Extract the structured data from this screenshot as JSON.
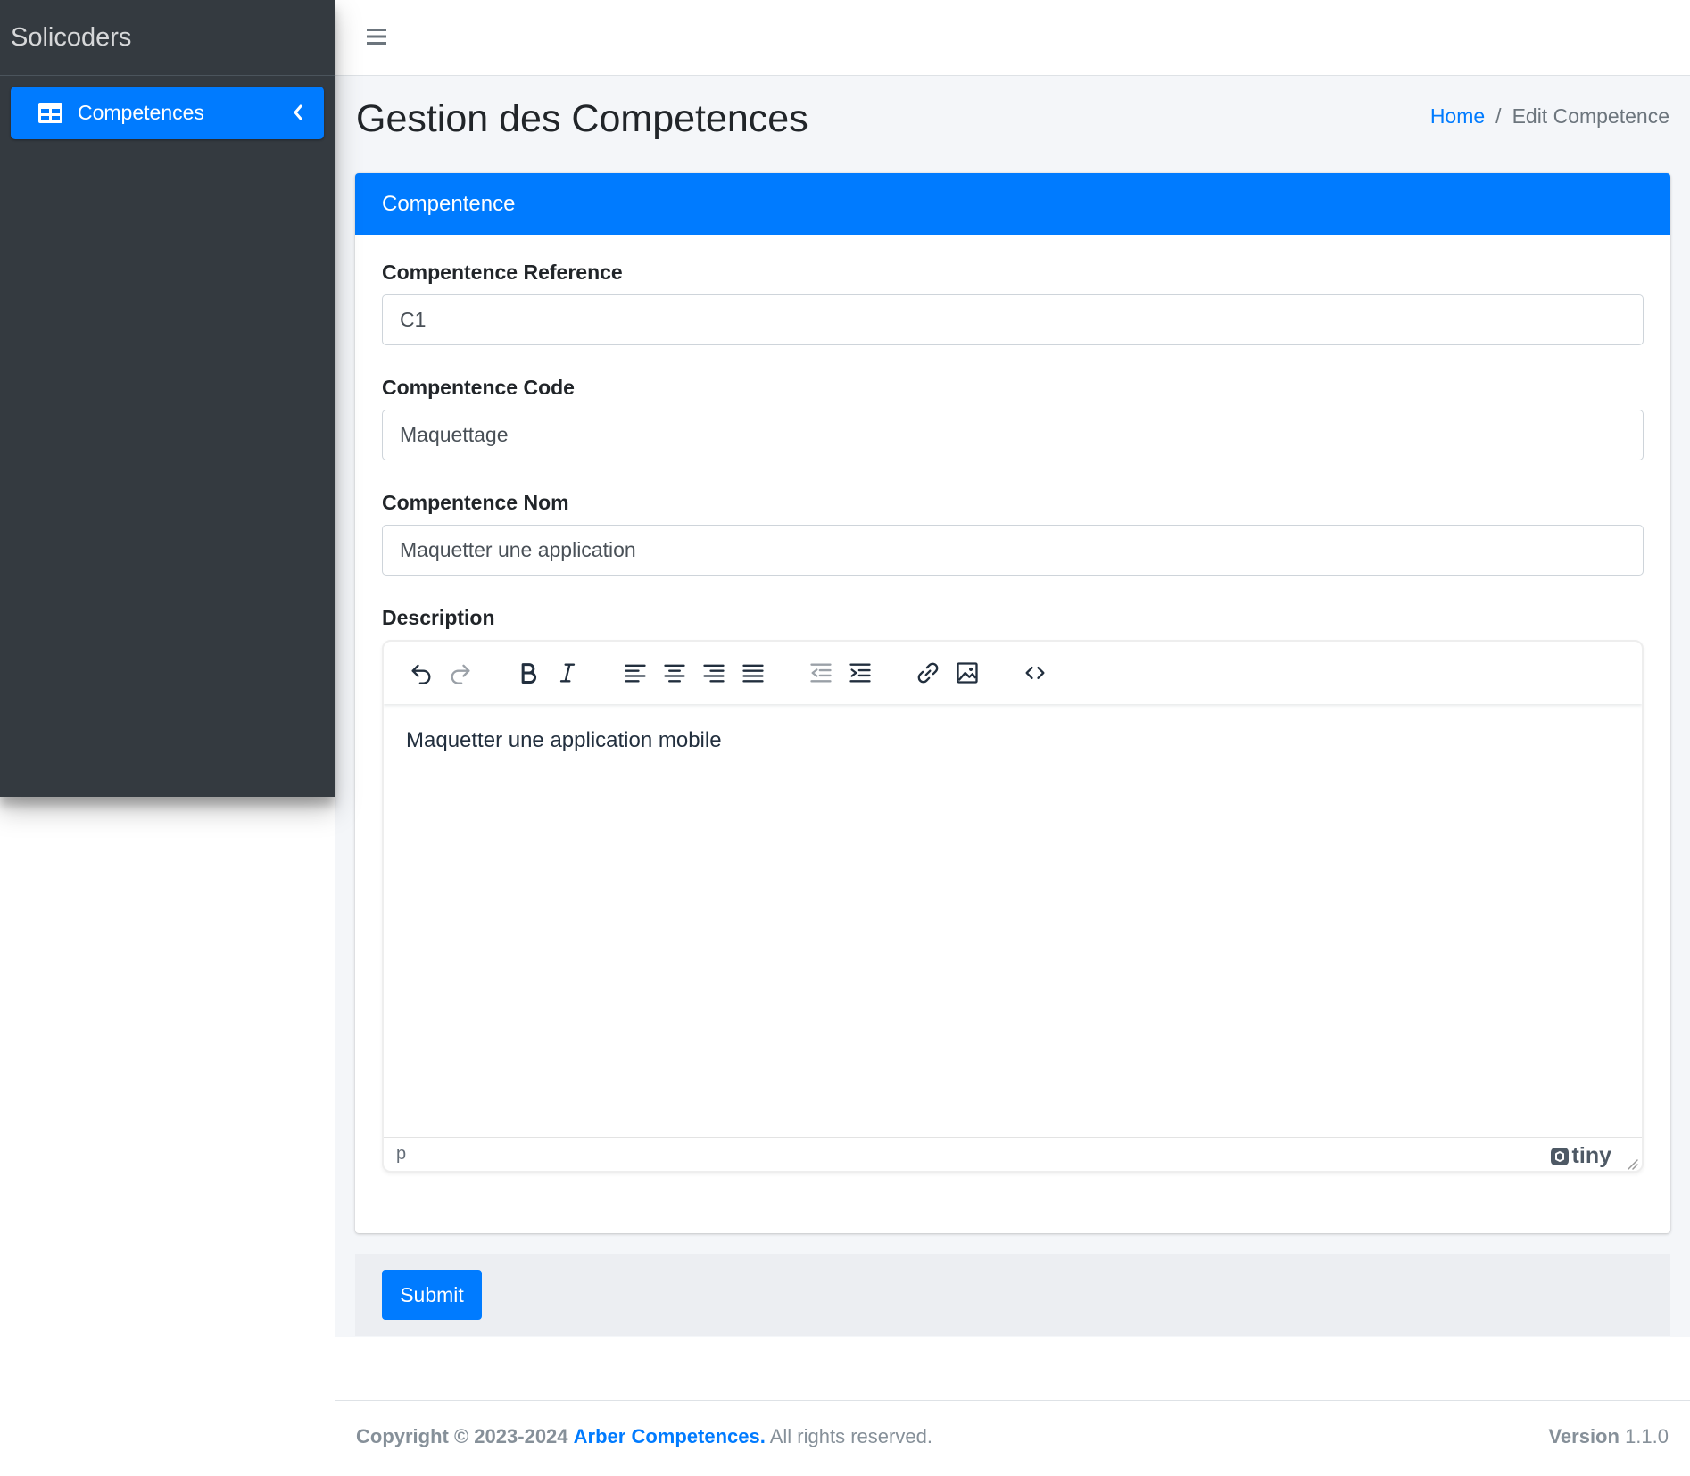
{
  "sidebar": {
    "brand": "Solicoders",
    "items": [
      {
        "label": "Competences",
        "icon": "table-icon",
        "active": true
      }
    ]
  },
  "header": {
    "page_title": "Gestion des Competences",
    "breadcrumb": {
      "home": "Home",
      "separator": "/",
      "current": "Edit Competence"
    }
  },
  "card": {
    "title": "Compentence",
    "fields": [
      {
        "label": "Compentence Reference",
        "value": "C1"
      },
      {
        "label": "Compentence Code",
        "value": "Maquettage"
      },
      {
        "label": "Compentence Nom",
        "value": "Maquetter une application"
      }
    ],
    "description": {
      "label": "Description",
      "content": "Maquetter une application mobile",
      "status_path": "p",
      "brand": "tiny",
      "toolbar": [
        "undo",
        "redo",
        "bold",
        "italic",
        "align-left",
        "align-center",
        "align-right",
        "justify",
        "outdent",
        "indent",
        "link",
        "image",
        "source-code"
      ]
    }
  },
  "footer_actions": {
    "submit_label": "Submit"
  },
  "footer": {
    "copyright": "Copyright © 2023-2024",
    "company": "Arber Competences.",
    "rights": "All rights reserved.",
    "version_label": "Version",
    "version": "1.1.0"
  },
  "colors": {
    "primary": "#007bff",
    "sidebar": "#343a40",
    "content_bg": "#f4f6f9"
  }
}
